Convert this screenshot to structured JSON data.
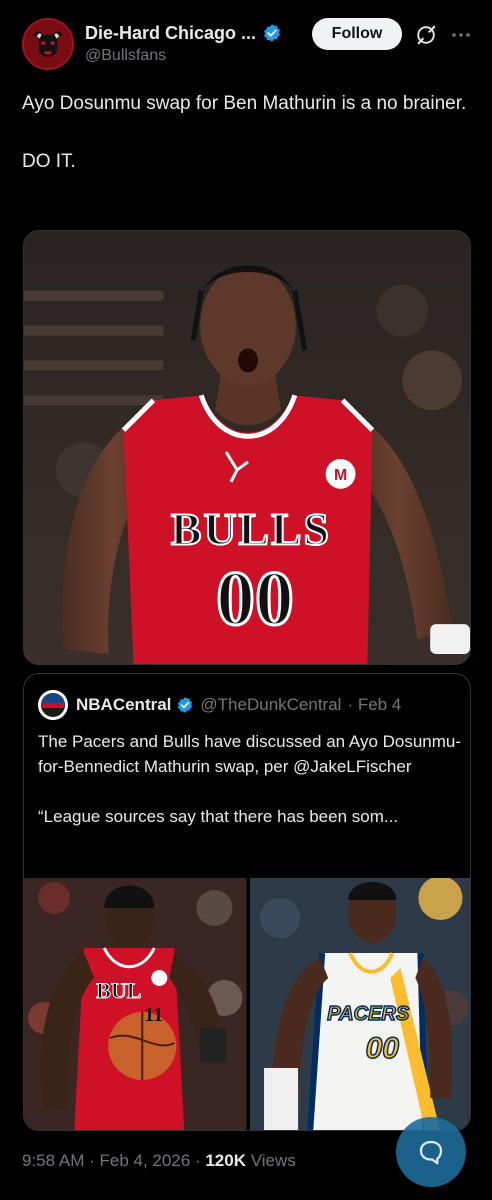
{
  "account": {
    "name": "Die-Hard Chicago ...",
    "handle": "@Bullsfans",
    "verified": true
  },
  "actions": {
    "follow_label": "Follow",
    "grok_icon": "grok-icon",
    "more_icon": "more-icon"
  },
  "tweet": {
    "line1": "Ayo Dosunmu swap for Ben Mathurin is a no brainer.",
    "line2": "DO IT."
  },
  "media": {
    "jersey_team": "BULLS",
    "jersey_number": "00"
  },
  "quote": {
    "name": "NBACentral",
    "handle": "@TheDunkCentral",
    "date": "· Feb 4",
    "text_line1": "The Pacers and Bulls have discussed an Ayo Dosunmu-for-Bennedict Mathurin swap, per @JakeLFischer",
    "text_line2": "“League sources say that there has been som...",
    "left_jersey_number": "11",
    "right_jersey_team": "PACERS",
    "right_jersey_number": "00"
  },
  "footer": {
    "timestamp": "9:58 AM · Feb 4, 2026 · ",
    "views_count": "120K",
    "views_label": " Views"
  },
  "colors": {
    "background": "#000000",
    "text": "#e7e9ea",
    "muted": "#71767b",
    "verified": "#1d9bf0",
    "bulls_red": "#ce1126",
    "pacers_gold": "#fdbb30",
    "pacers_blue": "#002d62"
  }
}
